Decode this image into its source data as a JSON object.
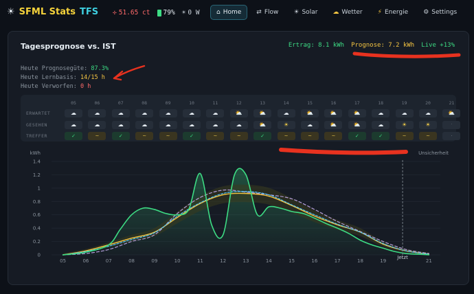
{
  "brand": {
    "icon": "sun-icon",
    "name_part1": "SFML Stats",
    "name_part2": "TFS"
  },
  "stats": {
    "price": "51.65 ct",
    "battery": "79%",
    "power": "0 W"
  },
  "nav": [
    {
      "label": "Home",
      "icon": "house-icon",
      "active": true
    },
    {
      "label": "Flow",
      "icon": "flow-icon"
    },
    {
      "label": "Solar",
      "icon": "sun-icon"
    },
    {
      "label": "Wetter",
      "icon": "cloud-sun-icon"
    },
    {
      "label": "Energie",
      "icon": "bolt-icon"
    },
    {
      "label": "Settings",
      "icon": "gear-icon"
    }
  ],
  "card": {
    "title": "Tagesprognose vs. IST",
    "ertrag": "Ertrag: 8.1 kWh",
    "prognose": "Prognose: 7.2 kWh",
    "live": "Live +13%"
  },
  "info": {
    "line1_label": "Heute Prognosegüte:",
    "line1_value": "87.3%",
    "line2_label": "Heute Lernbasis:",
    "line2_value": "14/15 h",
    "line3_label": "Heute Verworfen:",
    "line3_value": "0 h"
  },
  "grid": {
    "row_labels": [
      "ERWARTET",
      "GESEHEN",
      "TREFFER"
    ],
    "hours": [
      "05",
      "06",
      "07",
      "08",
      "09",
      "10",
      "11",
      "12",
      "13",
      "14",
      "15",
      "16",
      "17",
      "18",
      "19",
      "20",
      "21"
    ],
    "expected": [
      "cloud",
      "cloud",
      "cloud",
      "cloud",
      "cloud",
      "cloud",
      "cloud",
      "sun-cloud",
      "sun-cloud",
      "cloud",
      "sun-cloud",
      "sun-cloud",
      "sun-cloud",
      "cloud",
      "cloud",
      "cloud",
      "sun-cloud"
    ],
    "seen": [
      "cloud",
      "cloud",
      "cloud",
      "cloud",
      "cloud",
      "cloud",
      "cloud",
      "cloud",
      "sun-cloud",
      "sun",
      "cloud",
      "sun-cloud",
      "sun-cloud",
      "cloud",
      "sun",
      "sun",
      "moon"
    ],
    "hit": [
      "hit",
      "partial",
      "hit",
      "partial",
      "partial",
      "hit",
      "partial",
      "partial",
      "hit",
      "partial",
      "partial",
      "partial",
      "hit",
      "hit",
      "partial",
      "partial",
      "none"
    ],
    "symbols": {
      "hit": "✓",
      "partial": "~",
      "none": "·"
    }
  },
  "chart_data": {
    "type": "line",
    "ylabel": "kWh",
    "uncertainty_label": "Unsicherheit",
    "now_label": "Jetzt",
    "now_x": 19.85,
    "ylim": [
      0,
      1.4
    ],
    "yticks": [
      0,
      0.2,
      0.4,
      0.6,
      0.8,
      1,
      1.2,
      1.4
    ],
    "xticks": [
      "05",
      "06",
      "07",
      "08",
      "09",
      "10",
      "11",
      "12",
      "13",
      "14",
      "15",
      "16",
      "17",
      "18",
      "19",
      "21"
    ],
    "xtick_values": [
      5,
      6,
      7,
      8,
      9,
      10,
      11,
      12,
      13,
      14,
      15,
      16,
      17,
      18,
      19,
      21
    ],
    "xlim": [
      4.5,
      21.5
    ],
    "series": [
      {
        "color": "#3ddc84",
        "width": 1.6,
        "x": [
          5,
          6,
          7,
          7.5,
          8,
          8.5,
          9,
          9.5,
          10,
          10.5,
          11,
          11.5,
          12,
          12.5,
          13,
          13.5,
          14,
          14.5,
          15,
          15.5,
          16,
          16.5,
          17,
          17.5,
          18,
          18.5,
          19,
          19.5,
          20,
          20.5,
          21
        ],
        "y": [
          0,
          0.04,
          0.15,
          0.38,
          0.6,
          0.7,
          0.68,
          0.62,
          0.6,
          0.68,
          1.22,
          0.45,
          0.3,
          1.2,
          1.2,
          0.6,
          0.72,
          0.7,
          0.65,
          0.62,
          0.55,
          0.47,
          0.4,
          0.32,
          0.22,
          0.15,
          0.1,
          0.05,
          0.02,
          0.01,
          0
        ]
      },
      {
        "color": "#f5c542",
        "width": 1.4,
        "x": [
          5,
          6,
          7,
          8,
          9,
          10,
          11,
          12,
          13,
          14,
          15,
          16,
          17,
          18,
          19,
          20,
          21
        ],
        "y": [
          0,
          0.06,
          0.15,
          0.25,
          0.34,
          0.56,
          0.77,
          0.9,
          0.92,
          0.88,
          0.74,
          0.58,
          0.45,
          0.34,
          0.16,
          0.06,
          0.01
        ]
      },
      {
        "color": "#4fc3f7",
        "width": 1.2,
        "dash": "3,2",
        "x": [
          5,
          6,
          7,
          8,
          9,
          10,
          11,
          12,
          13,
          14,
          15,
          16,
          17,
          18,
          19,
          20,
          21
        ],
        "y": [
          0,
          0.05,
          0.13,
          0.23,
          0.33,
          0.58,
          0.78,
          0.92,
          0.95,
          0.9,
          0.75,
          0.6,
          0.46,
          0.34,
          0.17,
          0.06,
          0.01
        ]
      },
      {
        "color": "#b39ddb",
        "width": 1.2,
        "dash": "4,3",
        "x": [
          5,
          6,
          7,
          8,
          9,
          10,
          11,
          12,
          13,
          14,
          15,
          16,
          17,
          18,
          19,
          20,
          21
        ],
        "y": [
          0,
          0.02,
          0.08,
          0.2,
          0.3,
          0.62,
          0.86,
          0.97,
          0.94,
          0.9,
          0.84,
          0.68,
          0.5,
          0.35,
          0.2,
          0.08,
          0.02
        ]
      }
    ]
  }
}
